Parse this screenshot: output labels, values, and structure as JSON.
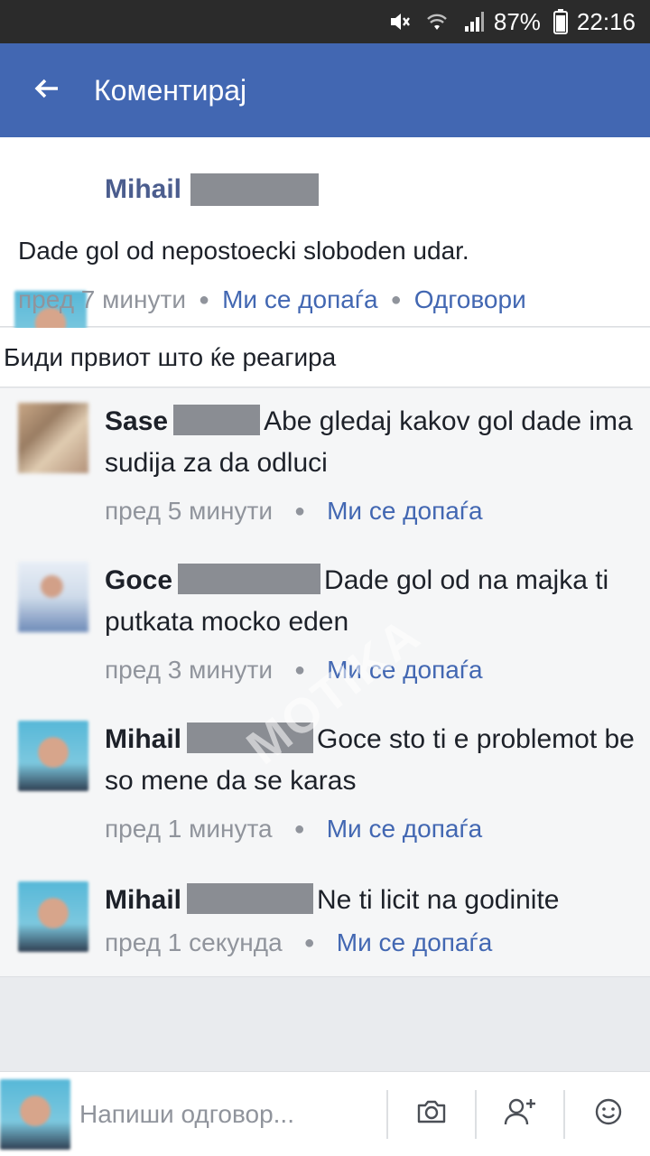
{
  "status_bar": {
    "battery": "87%",
    "time": "22:16",
    "watermark": "MOTIKA"
  },
  "app_bar": {
    "title": "Коментирај"
  },
  "post": {
    "author": "Mihail",
    "text": "Dade gol od nepostoecki sloboden udar.",
    "time": "пред 7 минути",
    "like_label": "Ми се допаѓа",
    "reply_label": "Одговори"
  },
  "reactions": {
    "prompt": "Биди првиот што ќе реагира"
  },
  "comments": [
    {
      "author": "Sase",
      "text": "Abe gledaj kakov gol dade ima sudija za da odluci",
      "time": "пред 5 минути",
      "like_label": "Ми се допаѓа"
    },
    {
      "author": "Goce",
      "text": "Dade gol od na majka ti putkata mocko eden",
      "time": "пред 3 минути",
      "like_label": "Ми се допаѓа"
    },
    {
      "author": "Mihail",
      "text": "Goce sto ti e problemot be so mene da se karas",
      "time": "пред 1 минута",
      "like_label": "Ми се допаѓа"
    },
    {
      "author": "Mihail",
      "text": "Ne ti licit na godinite",
      "time": "пред 1 секунда",
      "like_label": "Ми се допаѓа"
    }
  ],
  "watermark": "MOTIKA",
  "composer": {
    "placeholder": "Напиши одговор..."
  },
  "colors": {
    "brand": "#4267b2",
    "meta_gray": "#90949c",
    "panel_bg": "#f5f6f7"
  },
  "icons": [
    "mute-icon",
    "wifi-icon",
    "signal-icon",
    "battery-icon",
    "back-arrow-icon",
    "camera-icon",
    "add-friend-icon",
    "emoji-icon"
  ]
}
